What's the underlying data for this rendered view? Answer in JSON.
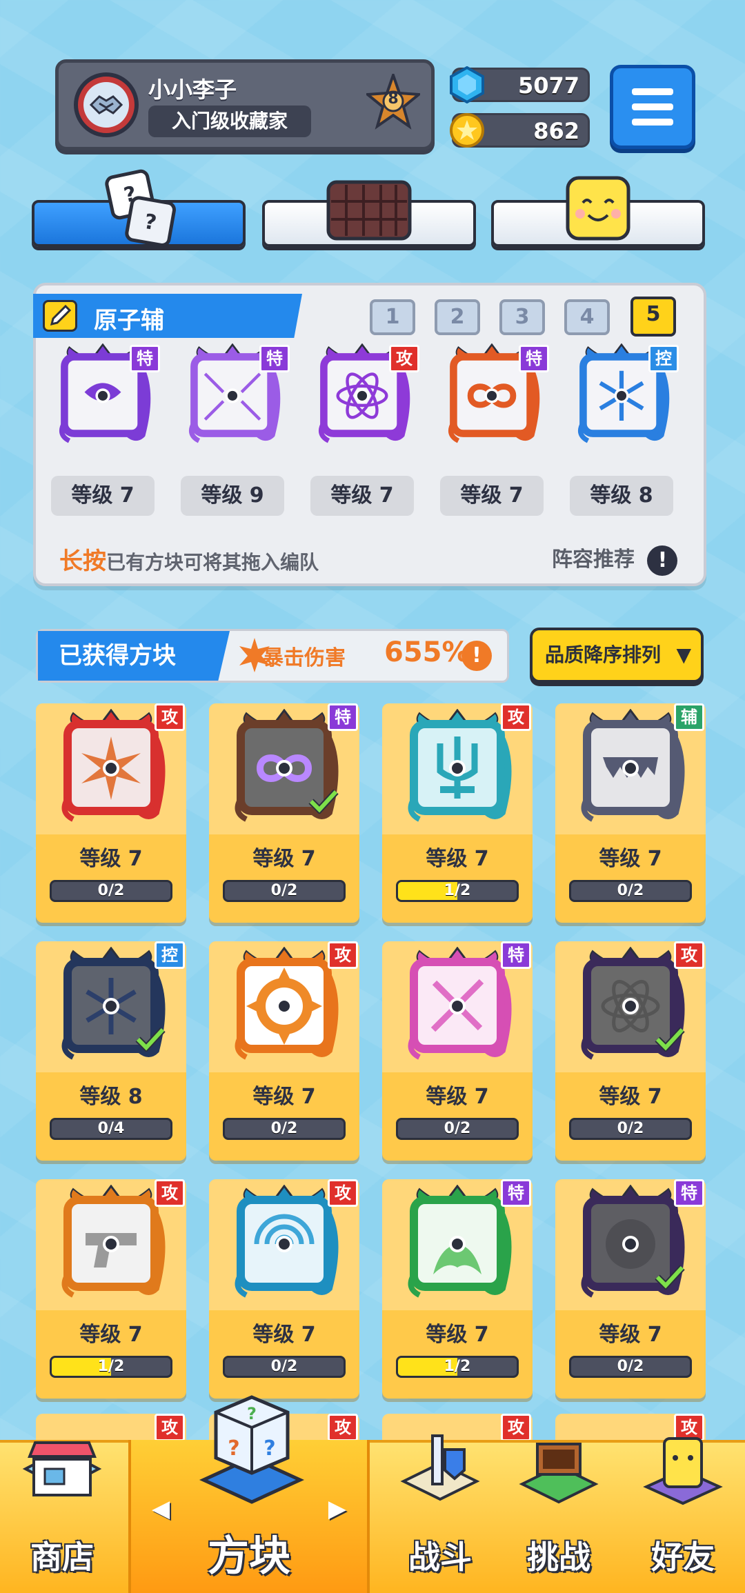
{
  "profile": {
    "name": "小小李子",
    "title": "入门级收藏家",
    "rank": "8"
  },
  "currency": {
    "gems": "5077",
    "coins": "862"
  },
  "category_tabs": [
    {
      "id": "dice",
      "icon": "dice-icon",
      "active": true
    },
    {
      "id": "board",
      "icon": "board-icon",
      "active": false
    },
    {
      "id": "face",
      "icon": "smiley-block-icon",
      "active": false
    }
  ],
  "lineup": {
    "deck_name": "原子辅",
    "slots": [
      "1",
      "2",
      "3",
      "4",
      "5"
    ],
    "selected_slot": "5",
    "cards": [
      {
        "tag": "特",
        "tag_color": "#8a3ad8",
        "level": "等级 7",
        "frame": "#7c3cd6",
        "symbol": "swirl"
      },
      {
        "tag": "特",
        "tag_color": "#8a3ad8",
        "level": "等级 9",
        "frame": "#9b5ce6",
        "symbol": "shatter"
      },
      {
        "tag": "攻",
        "tag_color": "#e0302b",
        "level": "等级 7",
        "frame": "#8e3ad8",
        "symbol": "atom"
      },
      {
        "tag": "特",
        "tag_color": "#8a3ad8",
        "level": "等级 7",
        "frame": "#e25a24",
        "symbol": "infinity"
      },
      {
        "tag": "控",
        "tag_color": "#2a8de6",
        "level": "等级 8",
        "frame": "#2a7fe0",
        "symbol": "snowflake"
      }
    ],
    "hint_em": "长按",
    "hint_rest": "已有方块可将其拖入编队",
    "recommend": "阵容推荐",
    "info": "!"
  },
  "obtained": {
    "title": "已获得方块",
    "crit_label": "暴击伤害",
    "crit_value": "655%",
    "info": "!",
    "sort": "品质降序排列",
    "sort_arrow": "▼"
  },
  "blocks": [
    {
      "tag": "攻",
      "tag_color": "#e0302b",
      "level": "等级 7",
      "progress": "0/2",
      "fill": 0,
      "frame": "#d8302f",
      "bg": "#f3e6e6",
      "symbol": "star-burst",
      "sym_color": "#e2763c",
      "equipped": false
    },
    {
      "tag": "特",
      "tag_color": "#8a3ad8",
      "level": "等级 7",
      "progress": "0/2",
      "fill": 0,
      "frame": "#6b3e2a",
      "bg": "#6c6c6c",
      "symbol": "infinity",
      "sym_color": "#b988ff",
      "equipped": true
    },
    {
      "tag": "攻",
      "tag_color": "#e0302b",
      "level": "等级 7",
      "progress": "1/2",
      "fill": 0.5,
      "frame": "#2aa7b8",
      "bg": "#d7f2f6",
      "symbol": "trident",
      "sym_color": "#2aa7b8",
      "equipped": false
    },
    {
      "tag": "辅",
      "tag_color": "#2aa368",
      "level": "等级 7",
      "progress": "0/2",
      "fill": 0,
      "frame": "#555a73",
      "bg": "#e5e5e8",
      "symbol": "jaw",
      "sym_color": "#555a73",
      "equipped": false
    },
    {
      "tag": "控",
      "tag_color": "#2a8de6",
      "level": "等级 8",
      "progress": "0/4",
      "fill": 0,
      "frame": "#24365c",
      "bg": "#5e636e",
      "symbol": "snowflake",
      "sym_color": "#2c3f6a",
      "equipped": true
    },
    {
      "tag": "攻",
      "tag_color": "#e0302b",
      "level": "等级 7",
      "progress": "0/2",
      "fill": 0,
      "frame": "#e8741c",
      "bg": "#ffffff",
      "symbol": "flame-ring",
      "sym_color": "#ef8a28",
      "equipped": false
    },
    {
      "tag": "特",
      "tag_color": "#8a3ad8",
      "level": "等级 7",
      "progress": "0/2",
      "fill": 0,
      "frame": "#d64fb4",
      "bg": "#fbe9f6",
      "symbol": "syringe",
      "sym_color": "#e06fc6",
      "equipped": false
    },
    {
      "tag": "攻",
      "tag_color": "#e0302b",
      "level": "等级 7",
      "progress": "0/2",
      "fill": 0,
      "frame": "#3a2a5a",
      "bg": "#6a6a6a",
      "symbol": "atom",
      "sym_color": "#555",
      "equipped": true
    },
    {
      "tag": "攻",
      "tag_color": "#e0302b",
      "level": "等级 7",
      "progress": "1/2",
      "fill": 0.5,
      "frame": "#e07a1c",
      "bg": "#f2f2f2",
      "symbol": "gun",
      "sym_color": "#9a9a9a",
      "equipped": false
    },
    {
      "tag": "攻",
      "tag_color": "#e0302b",
      "level": "等级 7",
      "progress": "0/2",
      "fill": 0,
      "frame": "#1e8fc0",
      "bg": "#e7f4fa",
      "symbol": "vortex",
      "sym_color": "#3ea6d8",
      "equipped": false
    },
    {
      "tag": "特",
      "tag_color": "#8a3ad8",
      "level": "等级 7",
      "progress": "1/2",
      "fill": 0.5,
      "frame": "#2aa34a",
      "bg": "#eef9ef",
      "symbol": "leaf",
      "sym_color": "#6cc872",
      "equipped": false
    },
    {
      "tag": "特",
      "tag_color": "#8a3ad8",
      "level": "等级 7",
      "progress": "0/2",
      "fill": 0,
      "frame": "#3a2a5a",
      "bg": "#5e5e63",
      "symbol": "shadow",
      "sym_color": "#3d3d44",
      "equipped": true
    }
  ],
  "partial_row_tags": [
    "攻",
    "攻",
    "攻",
    "攻"
  ],
  "nav": {
    "shop": "商店",
    "blocks": "方块",
    "battle": "战斗",
    "challenge": "挑战",
    "friends": "好友",
    "left_arrow": "◀",
    "right_arrow": "▶"
  }
}
